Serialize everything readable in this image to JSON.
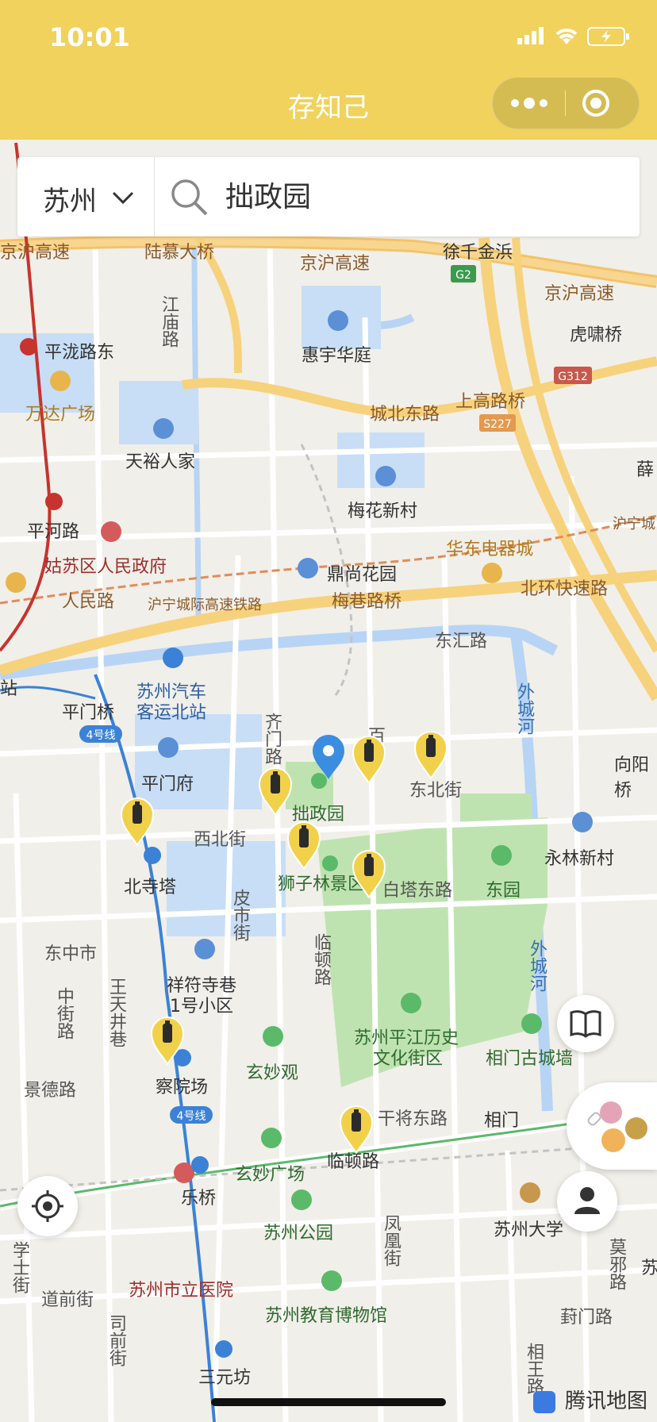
{
  "status": {
    "time": "10:01"
  },
  "nav": {
    "title": "存知己"
  },
  "search": {
    "city": "苏州",
    "query": "拙政园"
  },
  "map": {
    "labels": {
      "jinghu1": "京沪高速",
      "lumudaqiao": "陆慕大桥",
      "jinghu2": "京沪高速",
      "xuqianjinbang": "徐千金浜",
      "jinghu3": "京沪高速",
      "g2": "G2",
      "g312": "G312",
      "s227": "S227",
      "jiangmiaolu": "江庙路",
      "huiyuhuating": "惠宇华庭",
      "hushaqiao": "虎啸桥",
      "pinglongludong": "平泷路东",
      "wandaguangchang": "万达广场",
      "chengbeidonglu": "城北东路",
      "shanggaoluqiao": "上高路桥",
      "tianyurenjia": "天裕人家",
      "meihuaxincun": "梅花新村",
      "xue": "薛",
      "pinghelu": "平河路",
      "gusuquzhengfu": "姑苏区人民政府",
      "huadongdianqi": "华东电器城",
      "huningcheng": "沪宁城",
      "dingshanghuayuan": "鼎尚花园",
      "beihuankuaisulu": "北环快速路",
      "renminlu": "人民路",
      "huningrail": "沪宁城际高速铁路",
      "meixianglu": "梅巷路桥",
      "donghuilu": "东汇路",
      "zhan": "站",
      "suzhouqiche": "苏州汽车",
      "keyunbeizhan": "客运北站",
      "pingmenqiao": "平门桥",
      "line4a": "4号线",
      "waichenghe1": "外城河",
      "xiangyangqiao": "向阳桥",
      "qimenlu": "齐门路",
      "bai": "百",
      "pingmenfu": "平门府",
      "dongbeijie": "东北街",
      "zhuozhengyuan": "拙政园",
      "xibeijie": "西北街",
      "shizilin": "狮子林景区",
      "baitadonglu": "白塔东路",
      "dongyuan": "东园",
      "yonglinxincun": "永林新村",
      "beisita": "北寺塔",
      "pishijie": "皮市街",
      "lindunlu": "临顿路",
      "dongzhongshi": "东中市",
      "xiangfusixiang": "祥符寺巷",
      "xiaoqu": "1号小区",
      "zhongjielu": "中街路",
      "wangtianjingxiang": "王天井巷",
      "waichenghe2": "外城河",
      "pingjianglishi": "苏州平江历史",
      "wenhuajiequ": "文化街区",
      "xiangmengucheng": "相门古城墙",
      "jingdelu": "景德路",
      "chayuanchang": "察院场",
      "xuanmiaoguan": "玄妙观",
      "ganjianglu": "干将东路",
      "xiangmen": "相门",
      "line4b": "4号线",
      "xuanmiaoguangchang": "玄妙广场",
      "lindunlu2": "临顿路",
      "leqiao": "乐桥",
      "suzhougongyuan": "苏州公园",
      "fenghuangjie": "凤凰街",
      "suzhoudaxue": "苏州大学",
      "xueshijie": "学士街",
      "daoqianjie": "道前街",
      "suzhoushili": "苏州市立医院",
      "moxielu": "莫邪路",
      "jiaoyubowuguan": "苏州教育博物馆",
      "siqianjie": "司前街",
      "sanyuanfang": "三元坊",
      "xiangwangjie": "相王路",
      "fengmenqiao": "葑门路",
      "su": "苏",
      "wm": "腾讯地图"
    }
  },
  "colors": {
    "accent": "#f0d25c",
    "marker": "#f2d14a",
    "pin": "#3b8de0"
  }
}
